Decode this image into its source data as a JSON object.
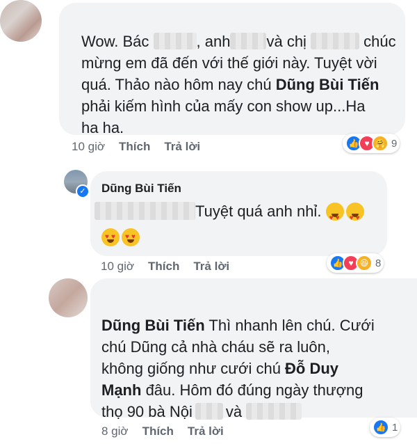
{
  "comments": [
    {
      "lines": [
        [
          "Wow. Bác ",
          "[blur]",
          ", anh",
          "[blur]",
          "và chị ",
          "[blur]",
          " chúc"
        ],
        [
          "mừng em đã đến với thế giới này. Tuyệt vời"
        ],
        [
          "quá. Thảo nào hôm nay chú ",
          "**Dũng Bùi Tiến**"
        ],
        [
          "phải kiếm hình của mấy con show up...Ha"
        ],
        [
          "ha ha."
        ]
      ],
      "time": "10 giờ",
      "like": "Thích",
      "reply": "Trả lời",
      "reaction_count": "9",
      "reactions": [
        "like-icon",
        "love-icon",
        "care-icon"
      ]
    },
    {
      "author": "Dũng Bùi Tiến",
      "text": "Tuyệt quá anh nhỉ.",
      "time": "10 giờ",
      "like": "Thích",
      "reply": "Trả lời",
      "reaction_count": "8",
      "reactions": [
        "like-icon",
        "love-icon",
        "haha-icon"
      ]
    },
    {
      "mention": "Dũng Bùi Tiến",
      "line1": " Thì nhanh lên chú. Cưới",
      "line2": "chú Dũng cả nhà cháu sẽ ra luôn,",
      "line3": "không giống như cưới chú ",
      "mention2": "Đỗ Duy",
      "line4a": "Mạnh",
      "line4b": " đâu. Hôm đó đúng ngày thượng",
      "line5a": "thọ 90 bà Nội",
      "line5b": "và",
      "time": "8 giờ",
      "like": "Thích",
      "reply": "Trả lời",
      "reaction_count": "1",
      "reactions": [
        "like-icon"
      ]
    }
  ],
  "colors": {
    "bubble": "#f2f3f5",
    "meta": "#606770",
    "like": "#1877f2",
    "love": "#f33e58",
    "haha": "#f7b125"
  }
}
